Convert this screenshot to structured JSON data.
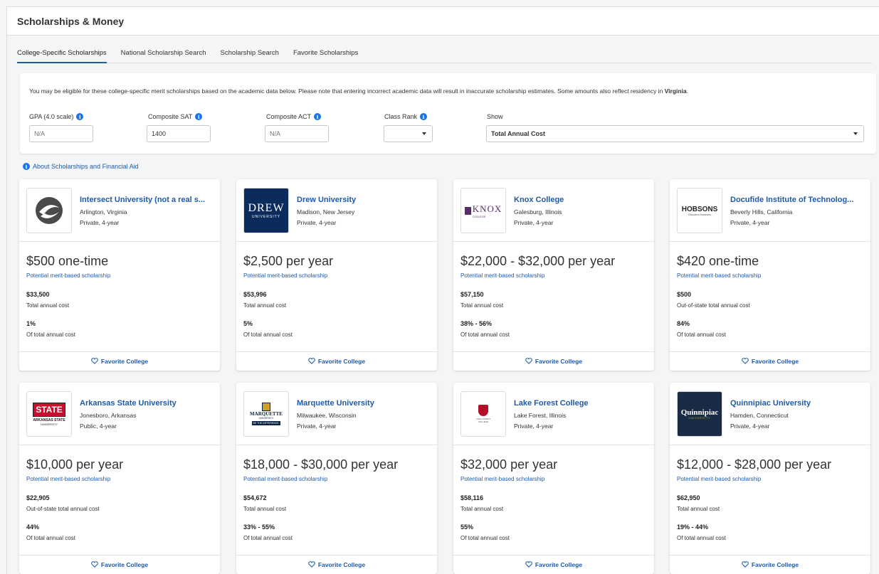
{
  "page": {
    "title": "Scholarships & Money"
  },
  "tabs": [
    {
      "label": "College-Specific Scholarships",
      "active": true
    },
    {
      "label": "National Scholarship Search",
      "active": false
    },
    {
      "label": "Scholarship Search",
      "active": false
    },
    {
      "label": "Favorite Scholarships",
      "active": false
    }
  ],
  "filters": {
    "notice": "You may be eligible for these college-specific merit scholarships based on the academic data below. Please note that entering incorrect academic data will result in inaccurate scholarship estimates. Some amounts also reflect residency in ",
    "residency": "Virginia",
    "notice_end": ".",
    "gpa": {
      "label": "GPA (4.0 scale)",
      "placeholder": "N/A"
    },
    "sat": {
      "label": "Composite SAT",
      "value": "1400"
    },
    "act": {
      "label": "Composite ACT",
      "placeholder": "N/A"
    },
    "class_rank": {
      "label": "Class Rank",
      "value": ""
    },
    "show": {
      "label": "Show",
      "value": "Total Annual Cost"
    },
    "info_glyph": "i"
  },
  "about_link": "About Scholarships and Financial Aid",
  "favorite_label": "Favorite College",
  "colors": {
    "link": "#1e5aa8",
    "info": "#1a73e8",
    "drew_navy": "#0b2b5c",
    "arkansas_red": "#c8102e",
    "quinnipiac_navy": "#1a2b45",
    "knox_purple": "#5b2a6e",
    "lakeforest_red": "#b0102b"
  },
  "colleges": [
    {
      "name": "Intersect University (not a real s...",
      "location": "Arlington, Virginia",
      "type": "Private, 4-year",
      "amount": "$500 one-time",
      "merit": "Potential merit-based scholarship",
      "cost": "$33,500",
      "cost_label": "Total annual cost",
      "pct": "1%",
      "pct_label": "Of total annual cost",
      "logo": "intersect-logo"
    },
    {
      "name": "Drew University",
      "location": "Madison, New Jersey",
      "type": "Private, 4-year",
      "amount": "$2,500 per year",
      "merit": "Potential merit-based scholarship",
      "cost": "$53,996",
      "cost_label": "Total annual cost",
      "pct": "5%",
      "pct_label": "Of total annual cost",
      "logo": "drew-logo",
      "logo_text": "DREW",
      "logo_sub": "UNIVERSITY"
    },
    {
      "name": "Knox College",
      "location": "Galesburg, Illinois",
      "type": "Private, 4-year",
      "amount": "$22,000 - $32,000 per year",
      "merit": "Potential merit-based scholarship",
      "cost": "$57,150",
      "cost_label": "Total annual cost",
      "pct": "38% - 56%",
      "pct_label": "Of total annual cost",
      "logo": "knox-logo",
      "logo_text": "KNOX",
      "logo_sub": "COLLEGE"
    },
    {
      "name": "Docufide Institute of Technolog...",
      "location": "Beverly Hills, California",
      "type": "Private, 4-year",
      "amount": "$420 one-time",
      "merit": "Potential merit-based scholarship",
      "cost": "$500",
      "cost_label": "Out-of-state total annual cost",
      "pct": "84%",
      "pct_label": "Of total annual cost",
      "logo": "hobsons-logo",
      "logo_text": "HOBSONS",
      "logo_sub": "Education Advances"
    },
    {
      "name": "Arkansas State University",
      "location": "Jonesboro, Arkansas",
      "type": "Public, 4-year",
      "amount": "$10,000 per year",
      "merit": "Potential merit-based scholarship",
      "cost": "$22,905",
      "cost_label": "Out-of-state total annual cost",
      "pct": "44%",
      "pct_label": "Of total annual cost",
      "logo": "arkansas-state-logo",
      "logo_text": "STATE",
      "logo_sub": "ARKANSAS STATE",
      "logo_sub2": "UNIVERSITY"
    },
    {
      "name": "Marquette University",
      "location": "Milwaukee, Wisconsin",
      "type": "Private, 4-year",
      "amount": "$18,000 - $30,000 per year",
      "merit": "Potential merit-based scholarship",
      "cost": "$54,672",
      "cost_label": "Total annual cost",
      "pct": "33% - 55%",
      "pct_label": "Of total annual cost",
      "logo": "marquette-logo",
      "logo_text": "MARQUETTE",
      "logo_sub": "UNIVERSITY",
      "logo_sub2": "BE THE DIFFERENCE."
    },
    {
      "name": "Lake Forest College",
      "location": "Lake Forest, Illinois",
      "type": "Private, 4-year",
      "amount": "$32,000 per year",
      "merit": "Potential merit-based scholarship",
      "cost": "$58,116",
      "cost_label": "Total annual cost",
      "pct": "55%",
      "pct_label": "Of total annual cost",
      "logo": "lake-forest-logo",
      "logo_text": "LAKE FOREST",
      "logo_sub": "COLLEGE"
    },
    {
      "name": "Quinnipiac University",
      "location": "Hamden, Connecticut",
      "type": "Private, 4-year",
      "amount": "$12,000 - $28,000 per year",
      "merit": "Potential merit-based scholarship",
      "cost": "$62,950",
      "cost_label": "Total annual cost",
      "pct": "19% - 44%",
      "pct_label": "Of total annual cost",
      "logo": "quinnipiac-logo",
      "logo_text": "Quinnipiac",
      "logo_sub": "UNIVERSITY"
    }
  ]
}
